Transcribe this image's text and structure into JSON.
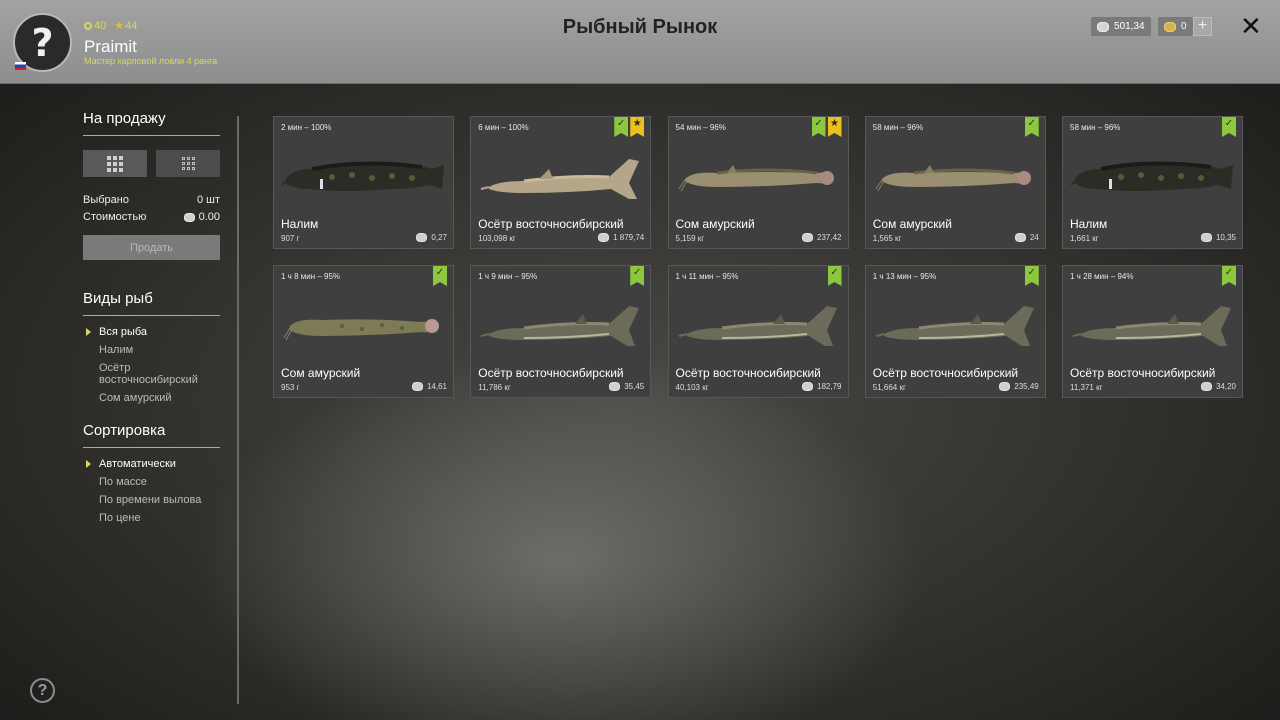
{
  "player": {
    "avatar_glyph": "?",
    "coins": "40",
    "stars": "44",
    "name": "Praimit",
    "rank": "Мастер карповой ловли 4 ранга"
  },
  "title": "Рыбный Рынок",
  "currency": {
    "silver": "501,34",
    "gold": "0",
    "add": "+"
  },
  "close": "✕",
  "sidebar": {
    "sale_heading": "На продажу",
    "selected_label": "Выбрано",
    "selected_value": "0 шт",
    "cost_label": "Стоимостью",
    "cost_value": "0.00",
    "sell_button": "Продать",
    "species_heading": "Виды рыб",
    "species": [
      "Вся рыба",
      "Налим",
      "Осётр восточносибирский",
      "Сом амурский"
    ],
    "sort_heading": "Сортировка",
    "sort": [
      "Автоматически",
      "По массе",
      "По времени вылова",
      "По цене"
    ]
  },
  "cards": [
    {
      "time": "2 мин – 100%",
      "name": "Налим",
      "weight": "907 г",
      "price": "0,27",
      "fish": "burbot",
      "check": false,
      "star": false
    },
    {
      "time": "6 мин – 100%",
      "name": "Осётр восточносибирский",
      "weight": "103,098 кг",
      "price": "1 879,74",
      "fish": "sturgeon",
      "check": true,
      "star": true
    },
    {
      "time": "54 мин – 96%",
      "name": "Сом амурский",
      "weight": "5,159 кг",
      "price": "237,42",
      "fish": "catfish",
      "check": true,
      "star": true
    },
    {
      "time": "58 мин – 96%",
      "name": "Сом амурский",
      "weight": "1,565 кг",
      "price": "24",
      "fish": "catfish",
      "check": true,
      "star": false
    },
    {
      "time": "58 мин – 96%",
      "name": "Налим",
      "weight": "1,661 кг",
      "price": "10,35",
      "fish": "burbot",
      "check": true,
      "star": false
    },
    {
      "time": "1 ч 8 мин – 95%",
      "name": "Сом амурский",
      "weight": "953 г",
      "price": "14,61",
      "fish": "catfish2",
      "check": true,
      "star": false
    },
    {
      "time": "1 ч 9 мин – 95%",
      "name": "Осётр восточносибирский",
      "weight": "11,786 кг",
      "price": "35,45",
      "fish": "sturgeon2",
      "check": true,
      "star": false
    },
    {
      "time": "1 ч 11 мин – 95%",
      "name": "Осётр восточносибирский",
      "weight": "40,103 кг",
      "price": "182,79",
      "fish": "sturgeon2",
      "check": true,
      "star": false
    },
    {
      "time": "1 ч 13 мин – 95%",
      "name": "Осётр восточносибирский",
      "weight": "51,664 кг",
      "price": "235,49",
      "fish": "sturgeon2",
      "check": true,
      "star": false
    },
    {
      "time": "1 ч 28 мин – 94%",
      "name": "Осётр восточносибирский",
      "weight": "11,371 кг",
      "price": "34,20",
      "fish": "sturgeon2",
      "check": true,
      "star": false
    }
  ],
  "help_glyph": "?"
}
